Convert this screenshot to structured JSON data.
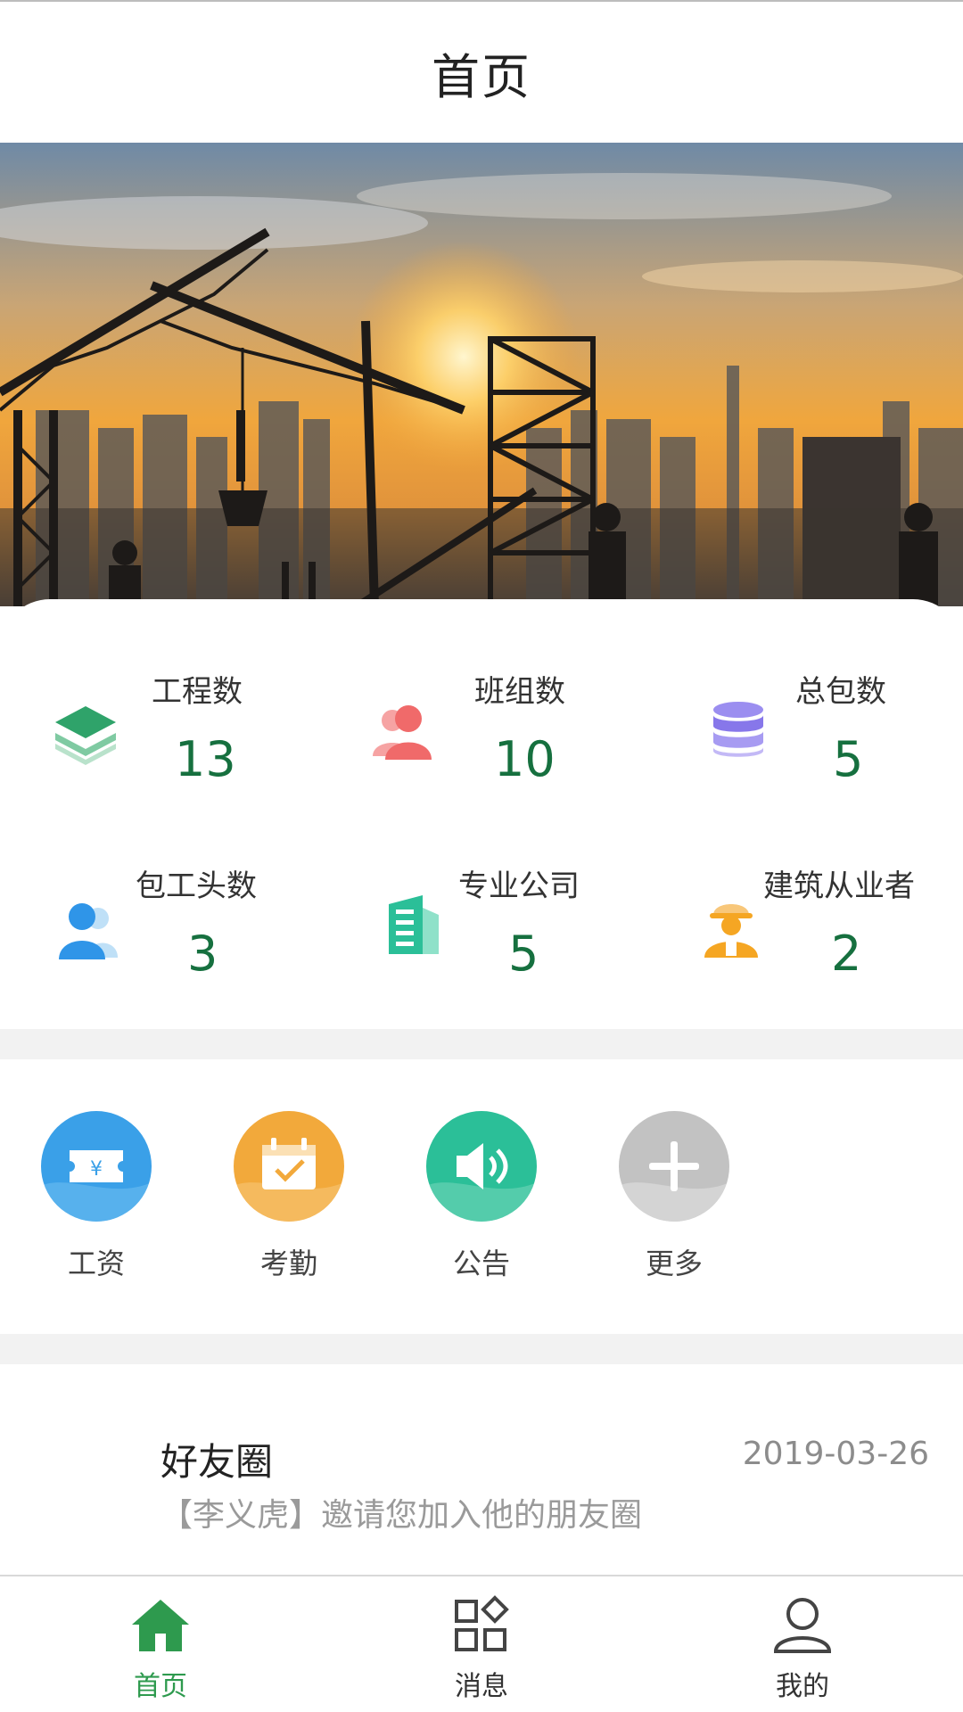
{
  "header": {
    "title": "首页"
  },
  "stats": [
    {
      "label": "工程数",
      "value": "13",
      "icon": "layers-icon"
    },
    {
      "label": "班组数",
      "value": "10",
      "icon": "group-icon"
    },
    {
      "label": "总包数",
      "value": "5",
      "icon": "database-icon"
    },
    {
      "label": "包工头数",
      "value": "3",
      "icon": "users-icon"
    },
    {
      "label": "专业公司",
      "value": "5",
      "icon": "building-icon"
    },
    {
      "label": "建筑从业者",
      "value": "2",
      "icon": "worker-icon"
    }
  ],
  "actions": [
    {
      "label": "工资",
      "icon": "salary-ticket-icon",
      "color": "#3aa0e8"
    },
    {
      "label": "考勤",
      "icon": "calendar-check-icon",
      "color": "#f2a93b"
    },
    {
      "label": "公告",
      "icon": "speaker-icon",
      "color": "#2bbf98"
    },
    {
      "label": "更多",
      "icon": "plus-icon",
      "color": "#c2c2c2"
    }
  ],
  "feed": {
    "title": "好友圈",
    "date": "2019-03-26",
    "description": "【李义虎】邀请您加入他的朋友圈"
  },
  "bottom_nav": [
    {
      "label": "首页",
      "icon": "home-icon",
      "active": true
    },
    {
      "label": "消息",
      "icon": "apps-icon",
      "active": false
    },
    {
      "label": "我的",
      "icon": "user-icon",
      "active": false
    }
  ],
  "colors": {
    "stat_value": "#16703f",
    "nav_active": "#2e9a4e",
    "separator": "#f2f2f2"
  }
}
